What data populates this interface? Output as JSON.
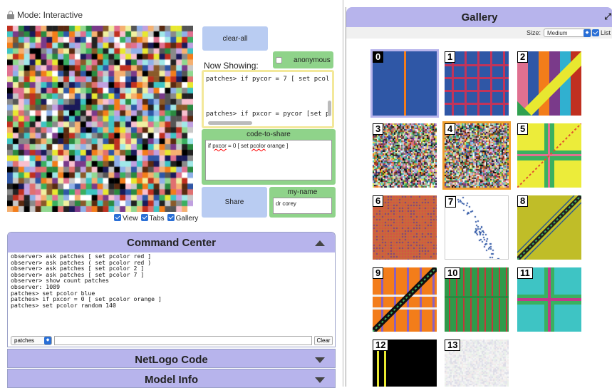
{
  "left": {
    "mode_label": "Mode: Interactive",
    "view_checks": {
      "view": "View",
      "tabs": "Tabs",
      "gallery": "Gallery"
    },
    "clear_all_label": "clear-all",
    "anonymous_label": "anonymous",
    "now_showing_label": "Now Showing:",
    "now_showing_lines": [
      "patches> if pycor = 7 [ set pcol",
      "patches> if pxcor = pycor [set p"
    ],
    "code_to_share": {
      "title": "code-to-share",
      "value_prefix": "if ",
      "value_word1": "pxcor",
      "value_mid": " = 0 [ set ",
      "value_word2": "pcolor",
      "value_suffix": " orange ]"
    },
    "share_label": "Share",
    "my_name": {
      "title": "my-name",
      "value": "dr corey"
    }
  },
  "command_center": {
    "title": "Command Center",
    "output": "observer> ask patches [ set pcolor red ]\nobserver> ask patches ( set pcolor red )\nobserver> ask patches [ set pcolor 2 ]\nobserver> ask patches [ set pcolor 7 ]\nobserver> show count patches\nobserver: 1089\npatches> set pcolor blue\npatches> if pxcor = 0 [ set pcolor orange ]\npatches> set pcolor random 140",
    "agent_select": "patches",
    "clear_label": "Clear"
  },
  "netlogo_code": {
    "title": "NetLogo Code"
  },
  "model_info": {
    "title": "Model Info"
  },
  "gallery": {
    "title": "Gallery",
    "size_label": "Size:",
    "size_value": "Medium",
    "list_label": "List",
    "tiles": [
      "0",
      "1",
      "2",
      "3",
      "4",
      "5",
      "6",
      "7",
      "8",
      "9",
      "10",
      "11",
      "12",
      "13"
    ]
  },
  "colors": {
    "accent_purple": "#b7b4ec",
    "button_blue": "#b9ccf2",
    "green": "#8fd38a",
    "yellow_border": "#f3e89a",
    "netlogo_blue": "#2f57a6",
    "netlogo_orange": "#f37d1a"
  }
}
